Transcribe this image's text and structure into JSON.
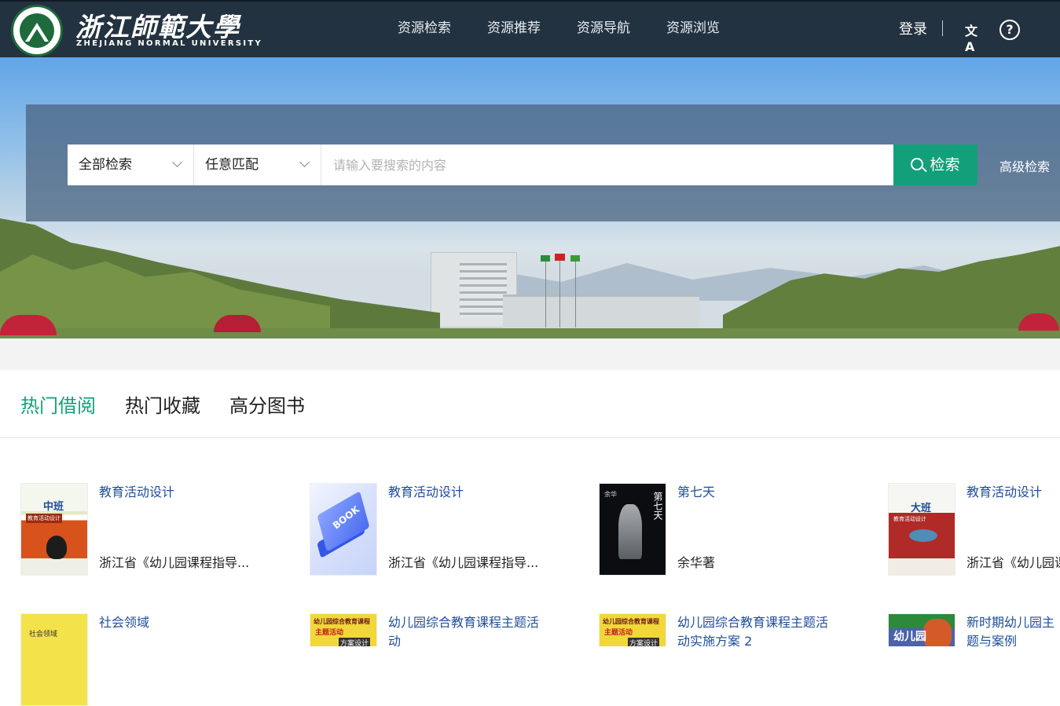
{
  "header": {
    "logo_title": "浙江師範大學",
    "logo_subtitle": "ZHEJIANG NORMAL UNIVERSITY",
    "nav": [
      "资源检索",
      "资源推荐",
      "资源导航",
      "资源浏览"
    ],
    "login": "登录",
    "translate_icon": "文A",
    "help_icon": "?"
  },
  "search": {
    "scope": "全部检索",
    "match": "任意匹配",
    "placeholder": "请输入要搜索的内容",
    "button": "检索",
    "advanced": "高级检索"
  },
  "tabs": [
    "热门借阅",
    "热门收藏",
    "高分图书"
  ],
  "books": [
    {
      "title": "教育活动设计",
      "author": "浙江省《幼儿园课程指导..."
    },
    {
      "title": "教育活动设计",
      "author": "浙江省《幼儿园课程指导..."
    },
    {
      "title": "第七天",
      "author": "余华著"
    },
    {
      "title": "教育活动设计",
      "author": "浙江省《幼儿园课程指导..."
    },
    {
      "title": "社会领域",
      "author": ""
    },
    {
      "title": "幼儿园综合教育课程主题活动",
      "author": ""
    },
    {
      "title": "幼儿园综合教育课程主题活动实施方案 2",
      "author": ""
    },
    {
      "title": "新时期幼儿园主题与案例",
      "author": ""
    }
  ],
  "covers": {
    "c1_title": "中班",
    "c1_sub": "教育活动设计",
    "c2_text": "BOOK",
    "c3_title": "第七天",
    "c3_author": "余华",
    "c4_title": "大班",
    "c4_sub": "教育活动设计",
    "c5_title": "社会领域",
    "c6_line1": "幼儿园综合教育课程",
    "c6_line2": "主题活动",
    "c6_line3": "方案设计",
    "c7_line1": "幼儿园综合教育课程",
    "c7_line2": "主题活动",
    "c7_line3": "方案设计",
    "c8_title": "幼儿园"
  },
  "colors": {
    "accent": "#12a07a",
    "header_bg": "#233240",
    "link": "#1f4e9a"
  }
}
